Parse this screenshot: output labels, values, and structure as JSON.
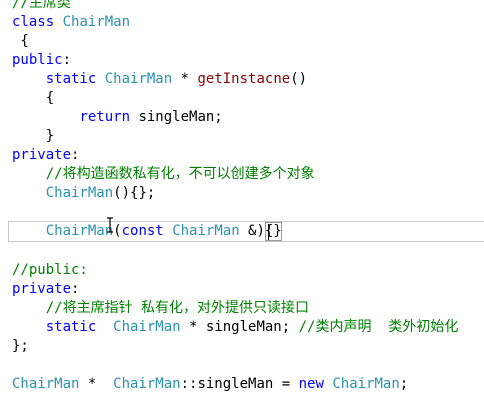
{
  "code_lines": [
    {
      "segments": [
        {
          "cls": "cm",
          "text": "//主席类"
        }
      ]
    },
    {
      "segments": [
        {
          "cls": "kw",
          "text": "class"
        },
        {
          "cls": "tx",
          "text": " "
        },
        {
          "cls": "ty",
          "text": "ChairMan"
        }
      ]
    },
    {
      "segments": [
        {
          "cls": "tx",
          "text": " {"
        }
      ]
    },
    {
      "segments": [
        {
          "cls": "kw",
          "text": "public"
        },
        {
          "cls": "tx",
          "text": ":"
        }
      ]
    },
    {
      "segments": [
        {
          "cls": "tx",
          "text": "    "
        },
        {
          "cls": "kw",
          "text": "static"
        },
        {
          "cls": "tx",
          "text": " "
        },
        {
          "cls": "ty",
          "text": "ChairMan"
        },
        {
          "cls": "tx",
          "text": " * "
        },
        {
          "cls": "fn",
          "text": "getInstacne"
        },
        {
          "cls": "tx",
          "text": "()"
        }
      ]
    },
    {
      "segments": [
        {
          "cls": "tx",
          "text": "    {"
        }
      ]
    },
    {
      "segments": [
        {
          "cls": "tx",
          "text": "        "
        },
        {
          "cls": "kw",
          "text": "return"
        },
        {
          "cls": "tx",
          "text": " singleMan;"
        }
      ]
    },
    {
      "segments": [
        {
          "cls": "tx",
          "text": "    }"
        }
      ]
    },
    {
      "segments": [
        {
          "cls": "kw",
          "text": "private"
        },
        {
          "cls": "tx",
          "text": ":"
        }
      ]
    },
    {
      "segments": [
        {
          "cls": "tx",
          "text": "    "
        },
        {
          "cls": "cm",
          "text": "//将构造函数私有化，不可以创建多个对象"
        }
      ]
    },
    {
      "segments": [
        {
          "cls": "tx",
          "text": "    "
        },
        {
          "cls": "ty",
          "text": "ChairMan"
        },
        {
          "cls": "tx",
          "text": "(){};"
        }
      ]
    },
    {
      "segments": []
    },
    {
      "segments": [
        {
          "cls": "tx",
          "text": "    "
        },
        {
          "cls": "ty",
          "text": "ChairMan"
        },
        {
          "cls": "tx",
          "text": "("
        },
        {
          "cls": "kw",
          "text": "const"
        },
        {
          "cls": "tx",
          "text": " "
        },
        {
          "cls": "ty",
          "text": "ChairMan"
        },
        {
          "cls": "tx",
          "text": " &)"
        },
        {
          "cls": "tx bracebox",
          "text": "{}"
        }
      ]
    },
    {
      "segments": []
    },
    {
      "segments": [
        {
          "cls": "cm",
          "text": "//public:"
        }
      ]
    },
    {
      "segments": [
        {
          "cls": "kw",
          "text": "private"
        },
        {
          "cls": "tx",
          "text": ":"
        }
      ]
    },
    {
      "segments": [
        {
          "cls": "tx",
          "text": "    "
        },
        {
          "cls": "cm",
          "text": "//将主席指针 私有化，对外提供只读接口"
        }
      ]
    },
    {
      "segments": [
        {
          "cls": "tx",
          "text": "    "
        },
        {
          "cls": "kw",
          "text": "static"
        },
        {
          "cls": "tx",
          "text": "  "
        },
        {
          "cls": "ty",
          "text": "ChairMan"
        },
        {
          "cls": "tx",
          "text": " * singleMan; "
        },
        {
          "cls": "cm",
          "text": "//类内声明  类外初始化"
        }
      ]
    },
    {
      "segments": [
        {
          "cls": "tx",
          "text": "};"
        }
      ]
    },
    {
      "segments": []
    },
    {
      "segments": [
        {
          "cls": "ty",
          "text": "ChairMan"
        },
        {
          "cls": "tx",
          "text": " *  "
        },
        {
          "cls": "ty",
          "text": "ChairMan"
        },
        {
          "cls": "tx",
          "text": "::singleMan = "
        },
        {
          "cls": "kw",
          "text": "new"
        },
        {
          "cls": "tx",
          "text": " "
        },
        {
          "cls": "ty",
          "text": "ChairMan"
        },
        {
          "cls": "tx",
          "text": ";"
        }
      ]
    }
  ]
}
